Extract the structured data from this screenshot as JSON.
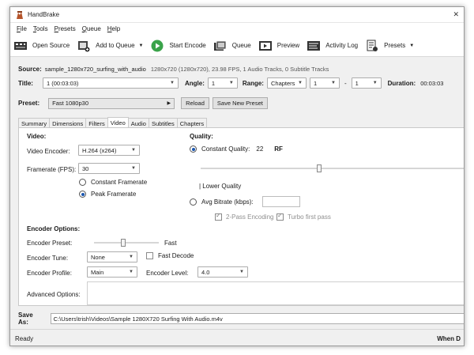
{
  "window": {
    "title": "HandBrake",
    "close_glyph": "✕"
  },
  "menu": [
    {
      "label": "File",
      "key": "F",
      "rest": "ile"
    },
    {
      "label": "Tools",
      "key": "T",
      "rest": "ools"
    },
    {
      "label": "Presets",
      "key": "P",
      "rest": "resets"
    },
    {
      "label": "Queue",
      "key": "Q",
      "rest": "ueue"
    },
    {
      "label": "Help",
      "key": "H",
      "rest": "elp"
    }
  ],
  "toolbar": {
    "open_source": "Open Source",
    "add_to_queue": "Add to Queue",
    "start_encode": "Start Encode",
    "queue": "Queue",
    "preview": "Preview",
    "activity_log": "Activity Log",
    "presets": "Presets"
  },
  "source": {
    "label": "Source:",
    "name": "sample_1280x720_surfing_with_audio",
    "info": "1280x720 (1280x720), 23.98 FPS, 1 Audio Tracks, 0 Subtitle Tracks"
  },
  "title_row": {
    "title_label": "Title:",
    "title_value": "1 (00:03:03)",
    "angle_label": "Angle:",
    "angle_value": "1",
    "range_label": "Range:",
    "range_mode": "Chapters",
    "range_start": "1",
    "range_sep": "-",
    "range_end": "1",
    "duration_label": "Duration:",
    "duration_value": "00:03:03"
  },
  "preset_row": {
    "label": "Preset:",
    "value": "Fast 1080p30",
    "reload": "Reload",
    "save_new": "Save New Preset"
  },
  "tabs": [
    "Summary",
    "Dimensions",
    "Filters",
    "Video",
    "Audio",
    "Subtitles",
    "Chapters"
  ],
  "active_tab": "Video",
  "video": {
    "section_title": "Video:",
    "encoder_label": "Video Encoder:",
    "encoder_value": "H.264 (x264)",
    "framerate_label": "Framerate (FPS):",
    "framerate_value": "30",
    "constant_framerate": "Constant Framerate",
    "peak_framerate": "Peak Framerate",
    "peak_selected": true
  },
  "quality": {
    "section_title": "Quality:",
    "constant_label": "Constant Quality:",
    "constant_value": "22",
    "rf_label": "RF",
    "lower_quality": "| Lower Quality",
    "avg_bitrate": "Avg Bitrate (kbps):",
    "two_pass": "2-Pass Encoding",
    "turbo": "Turbo first pass",
    "quality_slider_fraction": 0.44
  },
  "encoder_options": {
    "section_title": "Encoder Options:",
    "preset_label": "Encoder Preset:",
    "preset_value": "Fast",
    "preset_slider_fraction": 0.45,
    "tune_label": "Encoder Tune:",
    "tune_value": "None",
    "fast_decode": "Fast Decode",
    "profile_label": "Encoder Profile:",
    "profile_value": "Main",
    "level_label": "Encoder Level:",
    "level_value": "4.0",
    "advanced_label": "Advanced Options:"
  },
  "save_as": {
    "label": "Save As:",
    "path": "C:\\Users\\trish\\Videos\\Sample 1280X720 Surfing With Audio.m4v"
  },
  "status": {
    "left": "Ready",
    "right": "When D"
  },
  "colors": {
    "accent": "#1a56b0",
    "start_green": "#3aa34a"
  }
}
